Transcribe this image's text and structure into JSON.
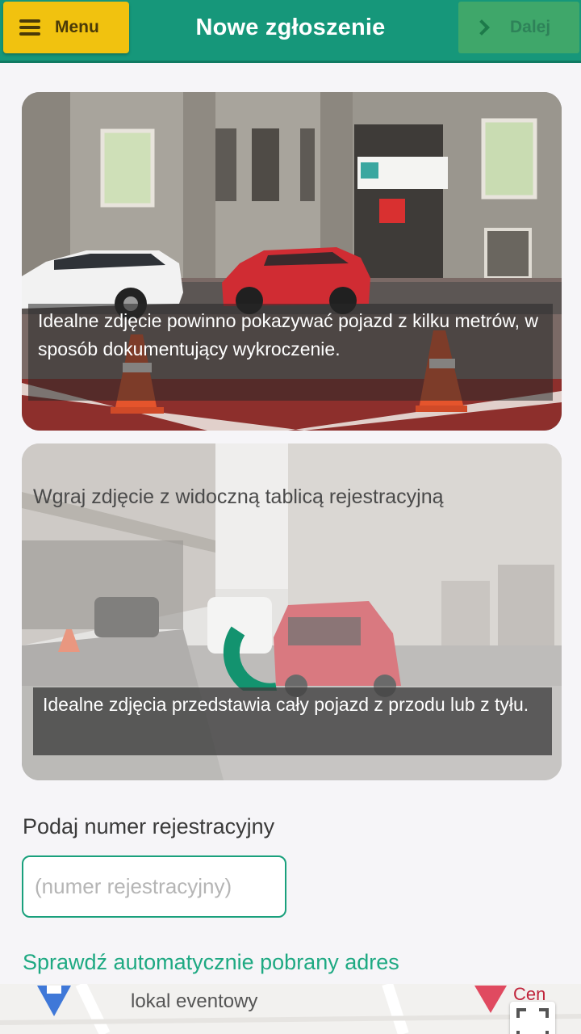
{
  "header": {
    "menu_label": "Menu",
    "title": "Nowe zgłoszenie",
    "next_label": "Dalej"
  },
  "photo_context": {
    "caption": "Idealne zdjęcie powinno pokazywać pojazd z kilku metrów, w sposób dokumentujący wykroczenie."
  },
  "photo_plate": {
    "upload_label": "Wgraj zdjęcie z widoczną tablicą rejestracyjną",
    "caption": "Idealne zdjęcia przedstawia cały pojazd z przodu lub z tyłu."
  },
  "plate": {
    "label": "Podaj numer rejestracyjny",
    "placeholder": "(numer rejestracyjny)",
    "value": ""
  },
  "address": {
    "label": "Sprawdź automatycznie pobrany adres"
  },
  "map": {
    "poi_label": "lokal eventowy",
    "poi_partial": "Cen"
  },
  "colors": {
    "header": "#16977a",
    "menu_button": "#f1c20f",
    "next_button": "#3fa76a",
    "accent": "#19a07c"
  }
}
